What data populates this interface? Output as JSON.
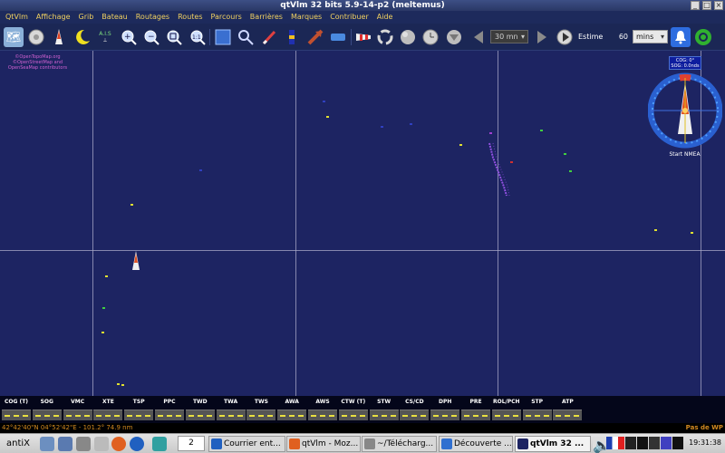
{
  "window": {
    "title": "qtVlm 32 bits 5.9-14-p2 (meltemus)"
  },
  "menu": [
    "QtVlm",
    "Affichage",
    "Grib",
    "Bateau",
    "Routages",
    "Routes",
    "Parcours",
    "Barrières",
    "Marques",
    "Contribuer",
    "Aide"
  ],
  "toolbar": {
    "icons": [
      "map-icon",
      "compass-icon",
      "boat-icon",
      "moon-icon",
      "ais-icon",
      "zoom-in-icon",
      "zoom-out-icon",
      "zoom-fit-icon",
      "zoom-1-1-icon",
      "square-icon",
      "search-icon",
      "pencil-icon",
      "barrier-icon",
      "route-icon",
      "ruler-icon",
      "windsock-icon",
      "recycle-icon",
      "sphere-icon",
      "clock-icon",
      "arrow-down-icon",
      "prev-icon",
      "next-icon",
      "play-icon",
      "bell-icon",
      "gps-icon"
    ],
    "ais_label": "A.I.S",
    "step": "30 mn",
    "estime_label": "Estime",
    "estime_value": "60",
    "unit": "mins"
  },
  "map": {
    "attribution": "©OpenTopoMap.org ©OpenStreetMap and OpenSeaMap contributors",
    "vlines": [
      102,
      326,
      549,
      773
    ],
    "hline": 276
  },
  "compass": {
    "cog": "COG: 0°",
    "sog": "SOG: 0.0nds",
    "status": "Start NMEA"
  },
  "instruments": [
    "COG (T)",
    "SOG",
    "VMC",
    "XTE",
    "TSP",
    "PPC",
    "TWD",
    "TWA",
    "TWS",
    "AWA",
    "AWS",
    "CTW (T)",
    "STW",
    "CS/CD",
    "DPH",
    "PRE",
    "ROL/PCH",
    "STP",
    "ATP"
  ],
  "status": {
    "coords": "42°42'40\"N 04°52'42\"E - 101.2° 74.9 nm",
    "waypoint": "Pas de WP"
  },
  "taskbar": {
    "start": "antiX",
    "workspace": "2",
    "tasks": [
      "Courrier ent...",
      "qtVlm - Moz...",
      "~/Télécharg...",
      "Découverte ...",
      "qtVlm 32 ..."
    ],
    "clock": "19:31:38"
  }
}
